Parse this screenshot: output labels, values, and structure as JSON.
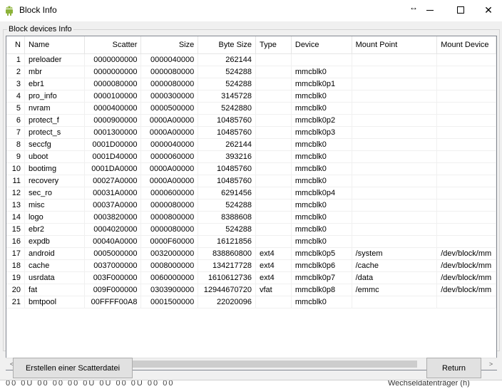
{
  "window": {
    "title": "Block Info",
    "resize_icon": "↔",
    "minimize_icon": "minimize-icon",
    "maximize_icon": "maximize-icon",
    "close_icon": "✕"
  },
  "group": {
    "label": "Block devices Info"
  },
  "table": {
    "columns": [
      "N",
      "Name",
      "Scatter",
      "Size",
      "Byte Size",
      "Type",
      "Device",
      "Mount Point",
      "Mount Device"
    ],
    "rows": [
      [
        "1",
        "preloader",
        "0000000000",
        "0000040000",
        "262144",
        "",
        "",
        "",
        ""
      ],
      [
        "2",
        "mbr",
        "0000000000",
        "0000080000",
        "524288",
        "",
        "mmcblk0",
        "",
        ""
      ],
      [
        "3",
        "ebr1",
        "0000080000",
        "0000080000",
        "524288",
        "",
        "mmcblk0p1",
        "",
        ""
      ],
      [
        "4",
        "pro_info",
        "0000100000",
        "0000300000",
        "3145728",
        "",
        "mmcblk0",
        "",
        ""
      ],
      [
        "5",
        "nvram",
        "0000400000",
        "0000500000",
        "5242880",
        "",
        "mmcblk0",
        "",
        ""
      ],
      [
        "6",
        "protect_f",
        "0000900000",
        "0000A00000",
        "10485760",
        "",
        "mmcblk0p2",
        "",
        ""
      ],
      [
        "7",
        "protect_s",
        "0001300000",
        "0000A00000",
        "10485760",
        "",
        "mmcblk0p3",
        "",
        ""
      ],
      [
        "8",
        "seccfg",
        "0001D00000",
        "0000040000",
        "262144",
        "",
        "mmcblk0",
        "",
        ""
      ],
      [
        "9",
        "uboot",
        "0001D40000",
        "0000060000",
        "393216",
        "",
        "mmcblk0",
        "",
        ""
      ],
      [
        "10",
        "bootimg",
        "0001DA0000",
        "0000A00000",
        "10485760",
        "",
        "mmcblk0",
        "",
        ""
      ],
      [
        "11",
        "recovery",
        "00027A0000",
        "0000A00000",
        "10485760",
        "",
        "mmcblk0",
        "",
        ""
      ],
      [
        "12",
        "sec_ro",
        "00031A0000",
        "0000600000",
        "6291456",
        "",
        "mmcblk0p4",
        "",
        ""
      ],
      [
        "13",
        "misc",
        "00037A0000",
        "0000080000",
        "524288",
        "",
        "mmcblk0",
        "",
        ""
      ],
      [
        "14",
        "logo",
        "0003820000",
        "0000800000",
        "8388608",
        "",
        "mmcblk0",
        "",
        ""
      ],
      [
        "15",
        "ebr2",
        "0004020000",
        "0000080000",
        "524288",
        "",
        "mmcblk0",
        "",
        ""
      ],
      [
        "16",
        "expdb",
        "00040A0000",
        "0000F60000",
        "16121856",
        "",
        "mmcblk0",
        "",
        ""
      ],
      [
        "17",
        "android",
        "0005000000",
        "0032000000",
        "838860800",
        "ext4",
        "mmcblk0p5",
        "/system",
        "/dev/block/mm"
      ],
      [
        "18",
        "cache",
        "0037000000",
        "0008000000",
        "134217728",
        "ext4",
        "mmcblk0p6",
        "/cache",
        "/dev/block/mm"
      ],
      [
        "19",
        "usrdata",
        "003F000000",
        "0060000000",
        "1610612736",
        "ext4",
        "mmcblk0p7",
        "/data",
        "/dev/block/mm"
      ],
      [
        "20",
        "fat",
        "009F000000",
        "0303900000",
        "12944670720",
        "vfat",
        "mmcblk0p8",
        "/emmc",
        "/dev/block/mm"
      ],
      [
        "21",
        "bmtpool",
        "00FFFF00A8",
        "0001500000",
        "22020096",
        "",
        "mmcblk0",
        "",
        ""
      ]
    ]
  },
  "scrollbar": {
    "left_arrow": "<",
    "right_arrow": ">"
  },
  "buttons": {
    "scatter": "Erstellen einer Scatterdatei",
    "return": "Return"
  },
  "background_strip": {
    "glyphs": "00  0U  00  00  00  0U  0U  00  0U  00  00",
    "text": "Wechseldatenträger (h)"
  },
  "colors": {
    "window_bg": "#f0f0f0",
    "list_bg": "#ffffff",
    "button_bg": "#e1e1e1",
    "icon_green": "#8db33a"
  }
}
